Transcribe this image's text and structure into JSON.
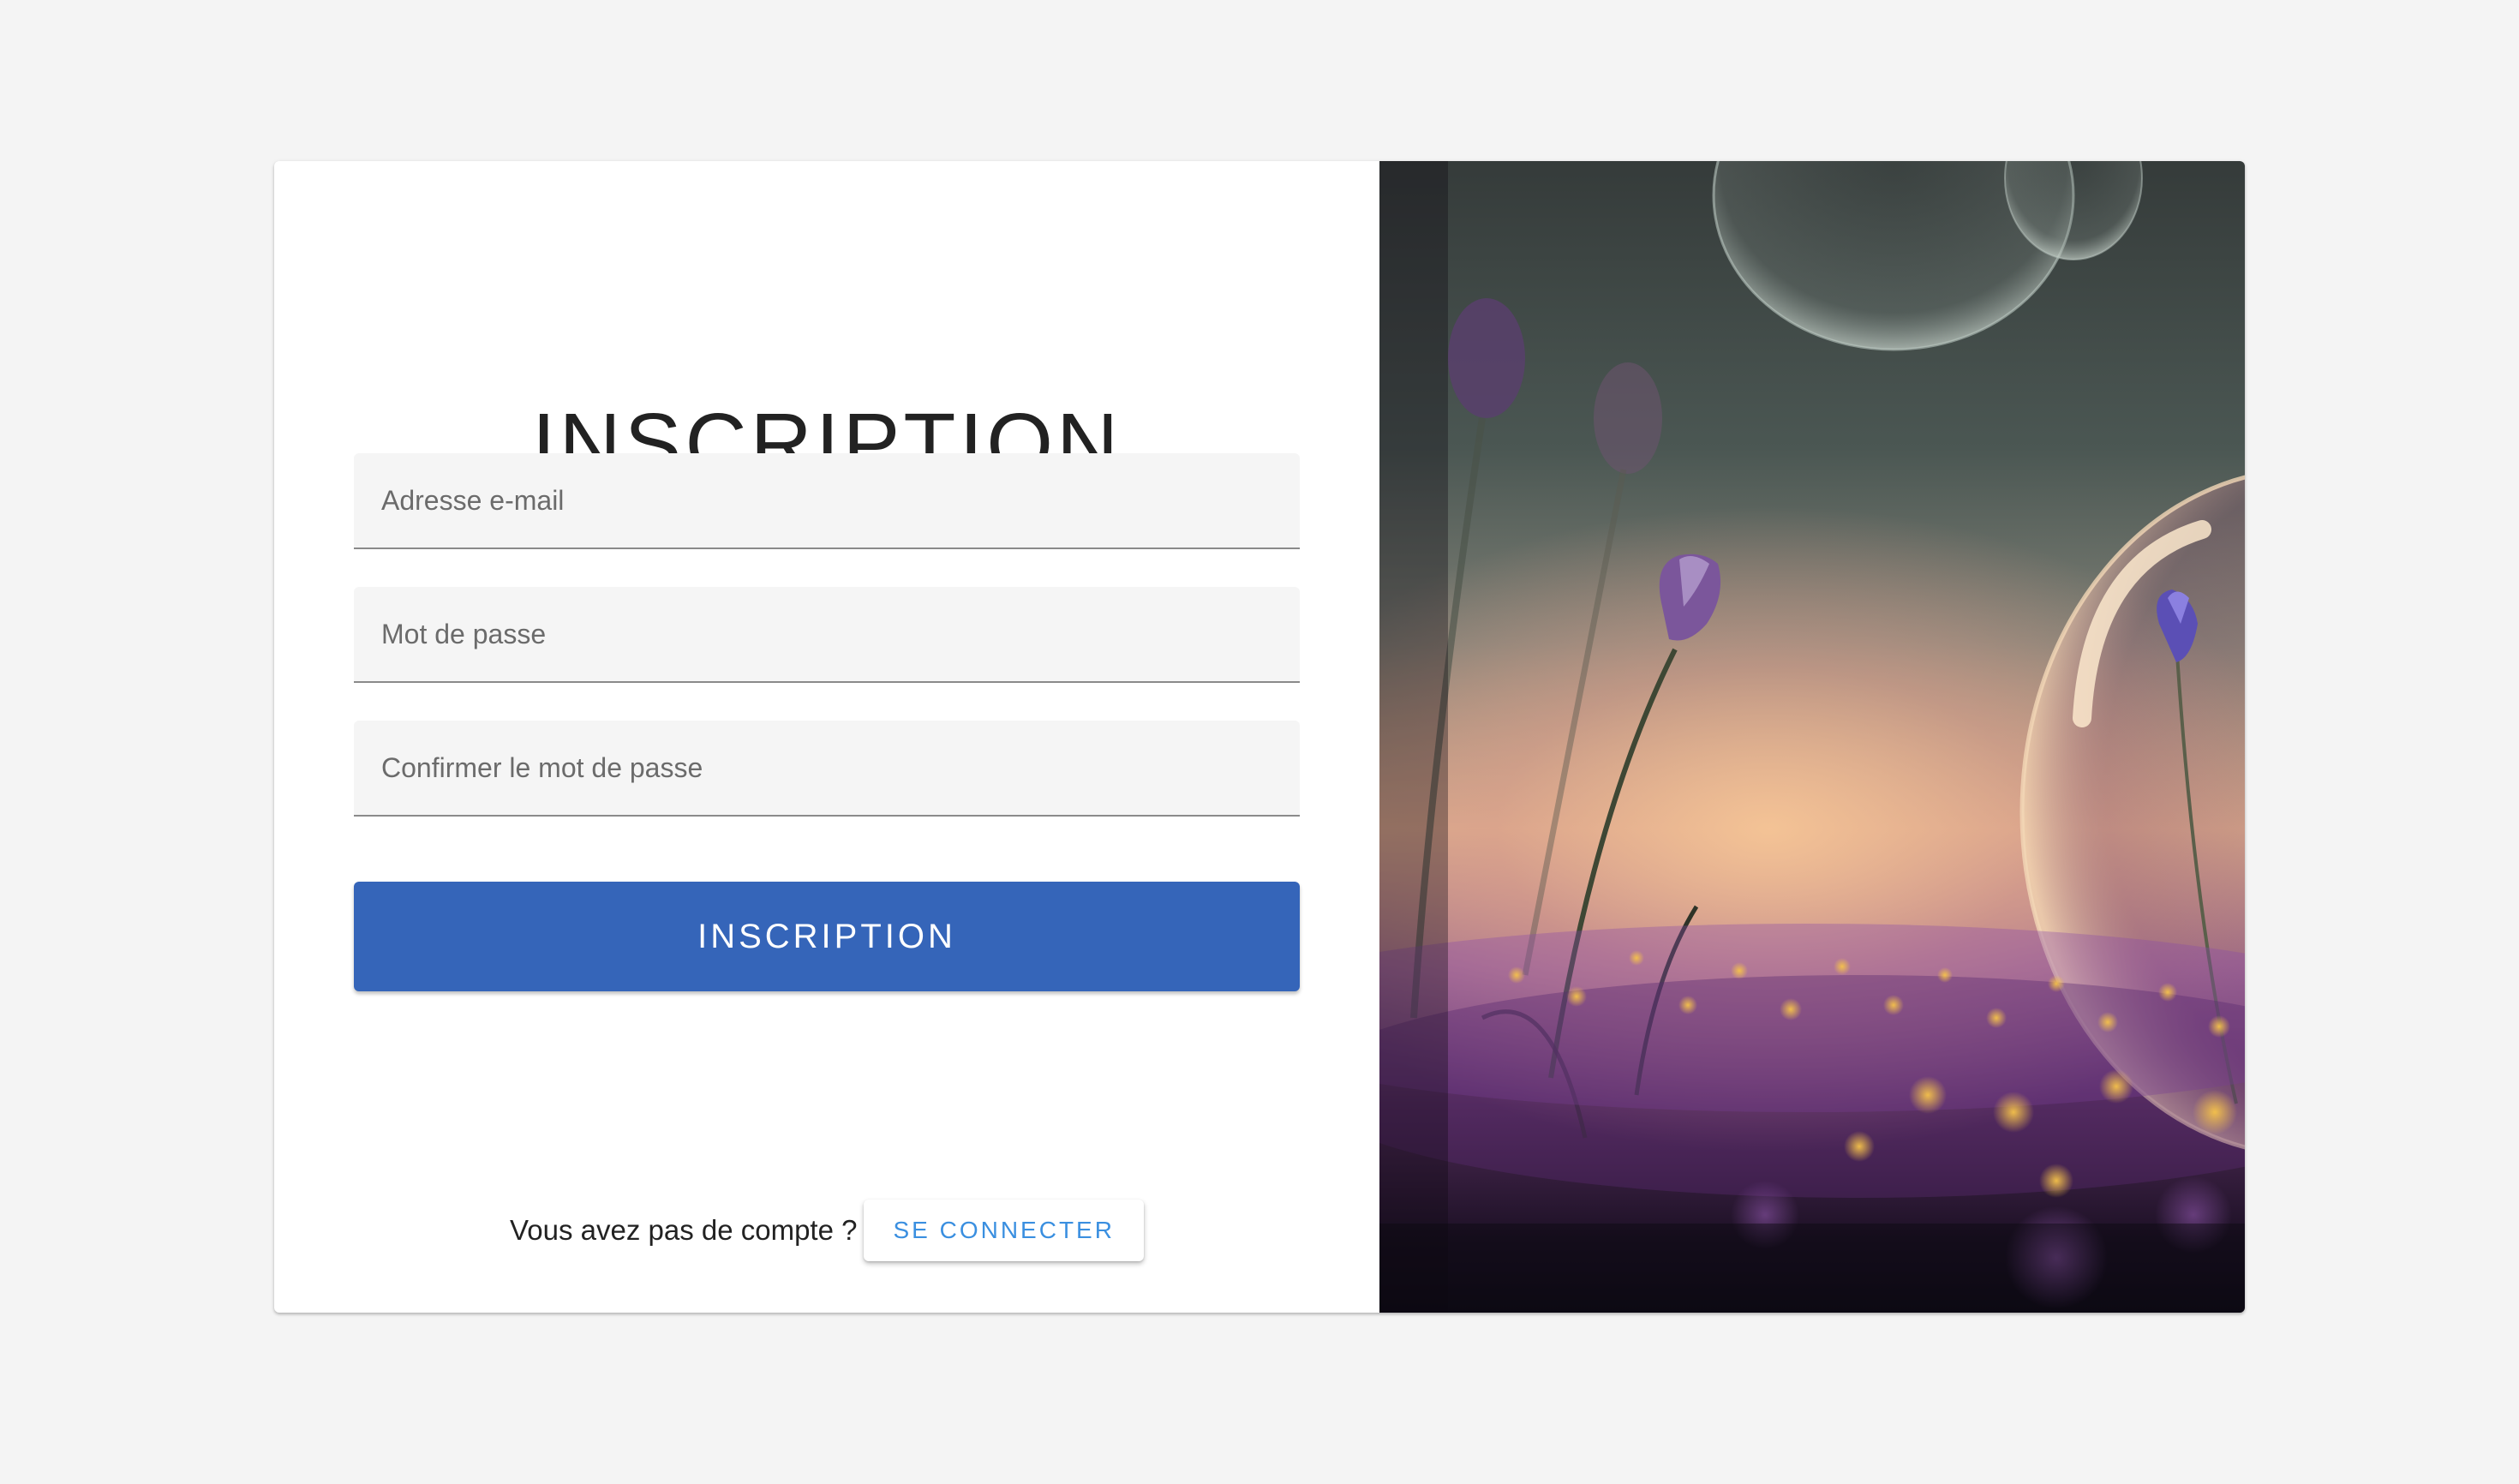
{
  "page_title": "INSCRIPTION",
  "form": {
    "email_placeholder": "Adresse e-mail",
    "password_placeholder": "Mot de passe",
    "confirm_placeholder": "Confirmer le mot de passe",
    "submit_label": "INSCRIPTION"
  },
  "footer": {
    "prompt": "Vous avez pas de compte ?",
    "login_label": "SE CONNECTER"
  },
  "colors": {
    "primary": "#3565b9",
    "link": "#3a8fe0",
    "background": "#f4f4f4"
  },
  "illustration": {
    "icon": "flower-bubble-illustration"
  }
}
